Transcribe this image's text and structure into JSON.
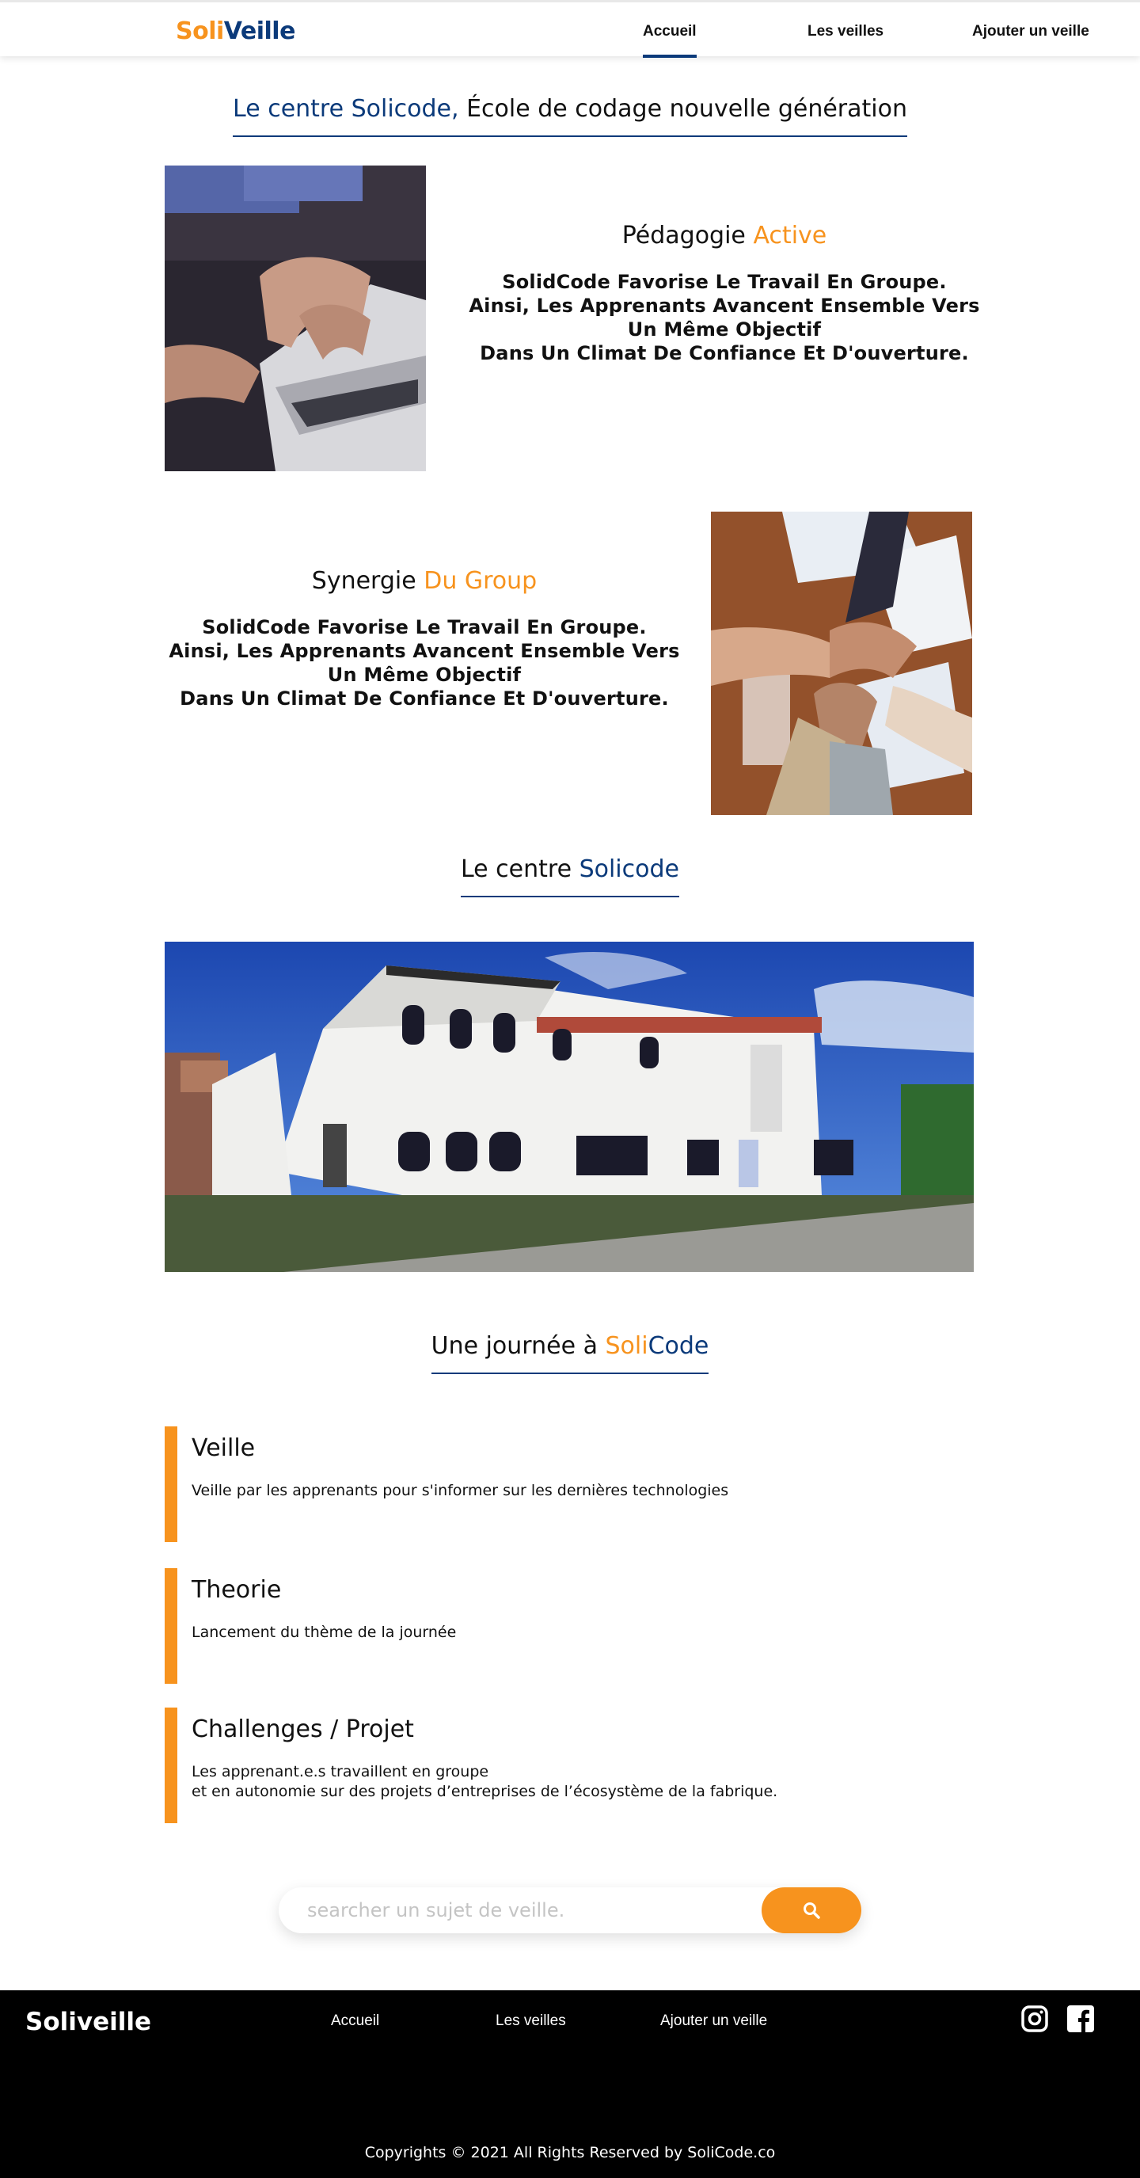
{
  "header": {
    "logo_part1": "Soli",
    "logo_part2": "Veille",
    "nav": [
      "Accueil",
      "Les veilles",
      "Ajouter un veille"
    ]
  },
  "intro": {
    "title_blue": "Le centre Solicode,",
    "title_rest": " École de codage nouvelle génération"
  },
  "pedagogie": {
    "title": "Pédagogie ",
    "title_accent": "Active",
    "lines": [
      "SolidCode Favorise Le Travail En Groupe.",
      "Ainsi, Les Apprenants Avancent Ensemble Vers",
      "Un Même Objectif",
      "Dans Un Climat De Confiance Et D'ouverture."
    ]
  },
  "synergie": {
    "title": "Synergie ",
    "title_accent": "Du Group",
    "lines": [
      "SolidCode Favorise Le Travail En Groupe.",
      "Ainsi, Les Apprenants Avancent Ensemble Vers",
      "Un Même Objectif",
      "Dans Un Climat De Confiance Et D'ouverture."
    ]
  },
  "centre": {
    "title": "Le centre ",
    "title_accent": "Solicode"
  },
  "journee": {
    "title": "Une journée à ",
    "accent_orange": "Soli",
    "accent_blue": "Code",
    "cards": [
      {
        "title": "Veille",
        "lines": [
          "Veille par les apprenants pour s'informer sur les dernières technologies"
        ]
      },
      {
        "title": "Theorie",
        "lines": [
          "Lancement du thème de la journée"
        ]
      },
      {
        "title": "Challenges / Projet",
        "lines": [
          "Les apprenant.e.s travaillent en groupe",
          "et en autonomie sur des projets d’entreprises de l’écosystème de la fabrique."
        ]
      }
    ]
  },
  "search": {
    "placeholder": "searcher un sujet de veille."
  },
  "footer": {
    "logo": "Soliveille",
    "links": [
      "Accueil",
      "Les veilles",
      "Ajouter un veille"
    ],
    "copyright": "Copyrights © 2021 All Rights Reserved by SoliCode.co"
  },
  "colors": {
    "brand_orange": "#f7931e",
    "brand_blue": "#0b3a7a"
  },
  "icons": [
    "search-icon",
    "instagram-icon",
    "facebook-icon"
  ]
}
